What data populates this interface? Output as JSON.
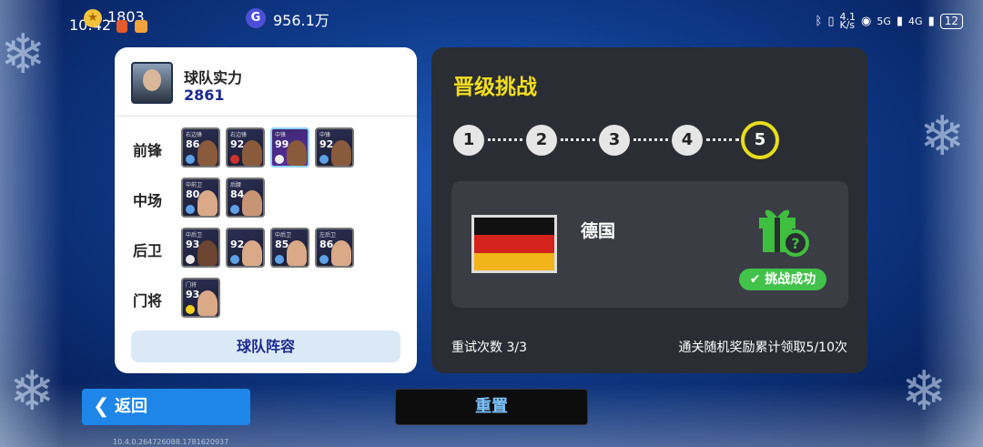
{
  "status_bar": {
    "time": "10:42",
    "coins": "1803",
    "gp_icon": "G",
    "gp_value": "956.1万",
    "net_speed": "4.1\nK/s",
    "signal_a": "5G",
    "signal_b": "4G",
    "battery": "12"
  },
  "team": {
    "title": "球队实力",
    "rating": "2861",
    "positions": [
      {
        "label": "前锋",
        "players": [
          {
            "tag": "右边锋",
            "rating": "86"
          },
          {
            "tag": "右边锋",
            "rating": "92"
          },
          {
            "tag": "中锋",
            "rating": "99",
            "special": true
          },
          {
            "tag": "中锋",
            "rating": "92"
          }
        ]
      },
      {
        "label": "中场",
        "players": [
          {
            "tag": "中前卫",
            "rating": "80"
          },
          {
            "tag": "后腰",
            "rating": "84"
          }
        ]
      },
      {
        "label": "后卫",
        "players": [
          {
            "tag": "中后卫",
            "rating": "93"
          },
          {
            "tag": "",
            "rating": "92"
          },
          {
            "tag": "中后卫",
            "rating": "85"
          },
          {
            "tag": "左后卫",
            "rating": "86"
          }
        ]
      },
      {
        "label": "门将",
        "players": [
          {
            "tag": "门将",
            "rating": "93"
          }
        ]
      }
    ],
    "lineup_button": "球队阵容"
  },
  "challenge": {
    "title": "晋级挑战",
    "steps": [
      "1",
      "2",
      "3",
      "4",
      "5"
    ],
    "current_step": "5",
    "country": "德国",
    "status_label": "✔ 挑战成功",
    "retry_text": "重试次数 3/3",
    "reward_progress": "通关随机奖励累计领取5/10次"
  },
  "footer": {
    "back_label": "返回",
    "reset_label": "重置",
    "version": "10.4.0.264726088.1781620937"
  },
  "colors": {
    "accent_yellow": "#f3df1c",
    "success_green": "#43c24b",
    "back_blue": "#1e86e8"
  }
}
